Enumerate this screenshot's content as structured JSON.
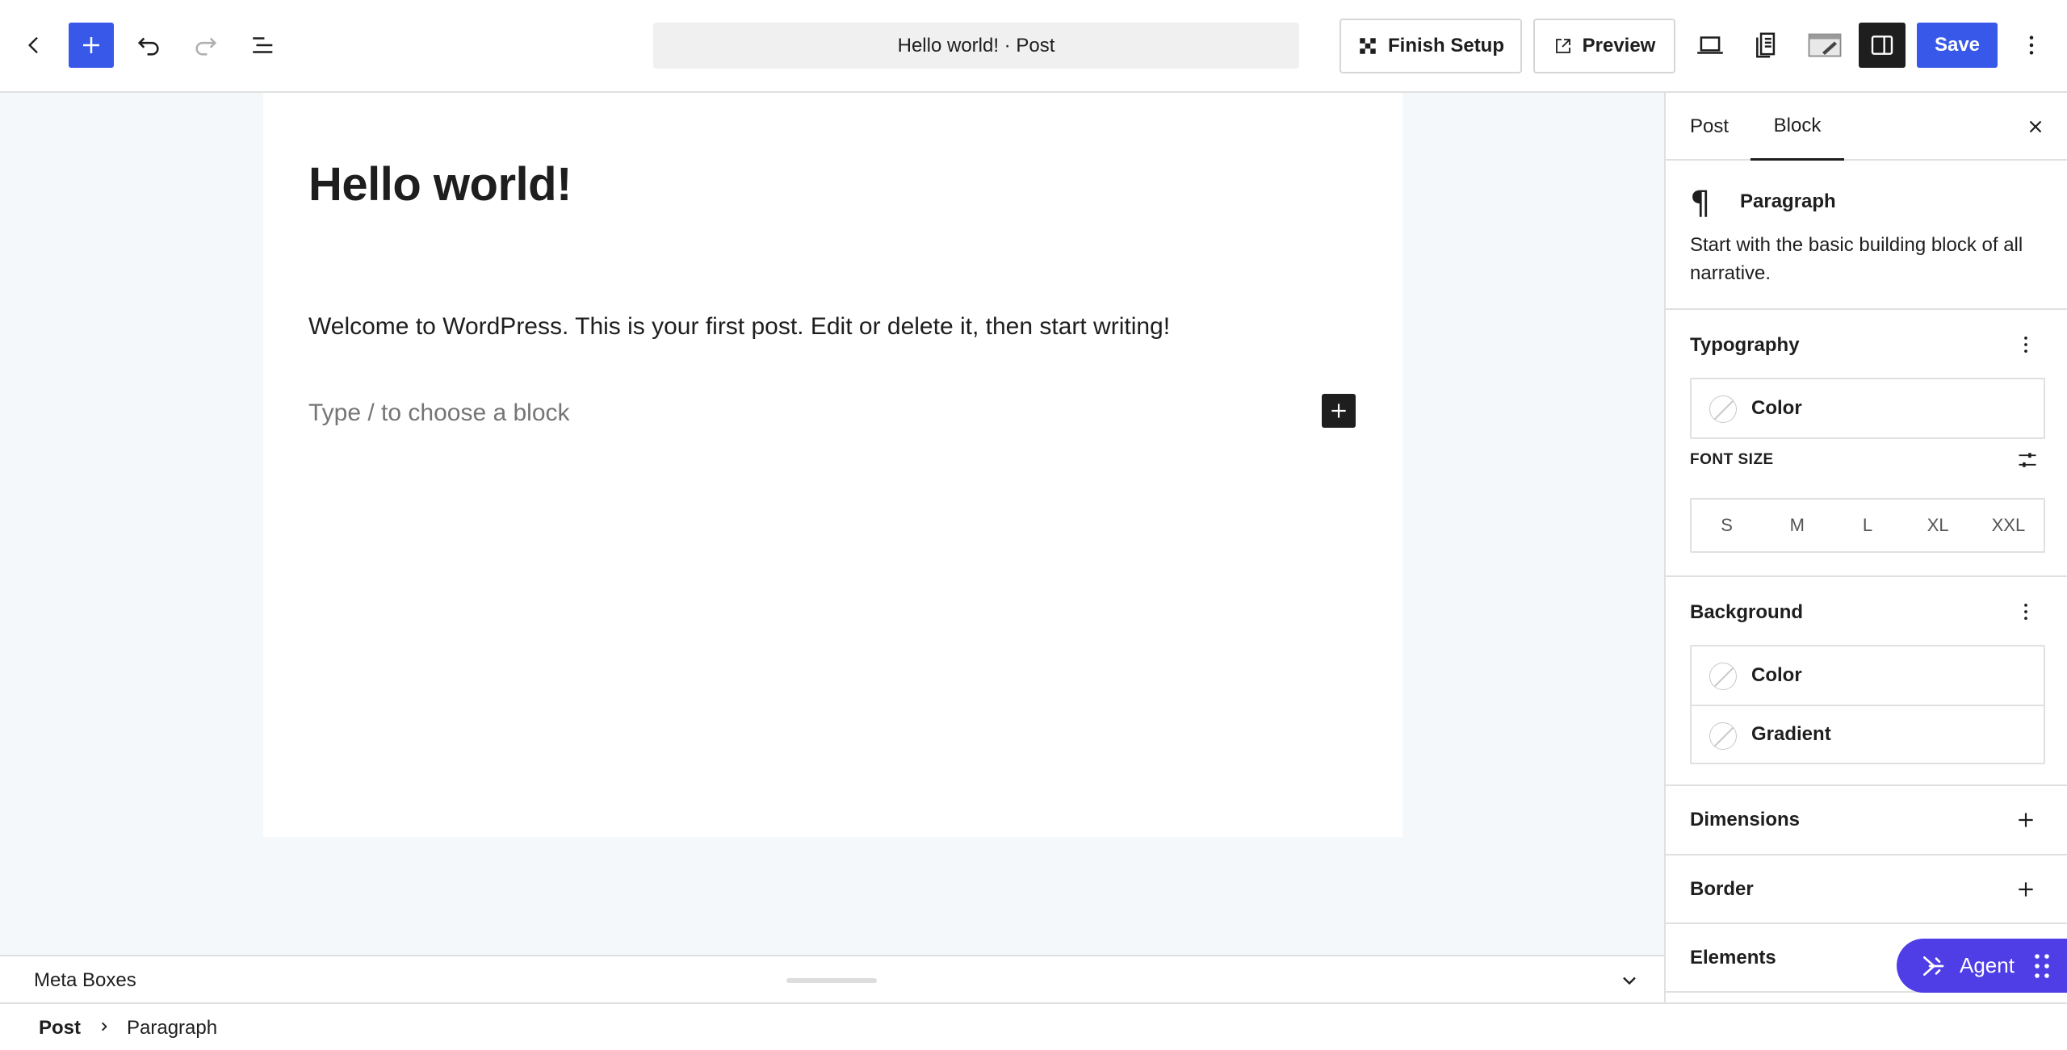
{
  "toolbar": {
    "document_title": "Hello world! · Post",
    "finish_setup_label": "Finish Setup",
    "preview_label": "Preview",
    "save_label": "Save"
  },
  "editor": {
    "post_title": "Hello world!",
    "paragraph_text": "Welcome to WordPress. This is your first post. Edit or delete it, then start writing!",
    "block_placeholder": "Type / to choose a block"
  },
  "meta_boxes": {
    "label": "Meta Boxes"
  },
  "breadcrumb": {
    "items": [
      "Post",
      "Paragraph"
    ]
  },
  "sidebar": {
    "tabs": [
      {
        "label": "Post",
        "active": false
      },
      {
        "label": "Block",
        "active": true
      }
    ],
    "block": {
      "icon": "paragraph-icon",
      "name": "Paragraph",
      "description": "Start with the basic building block of all narrative."
    },
    "typography": {
      "title": "Typography",
      "color_label": "Color",
      "font_size_label": "FONT SIZE",
      "font_sizes": [
        "S",
        "M",
        "L",
        "XL",
        "XXL"
      ]
    },
    "background": {
      "title": "Background",
      "items": [
        "Color",
        "Gradient"
      ]
    },
    "dimensions": {
      "title": "Dimensions"
    },
    "border": {
      "title": "Border"
    },
    "elements": {
      "title": "Elements"
    }
  },
  "agent": {
    "label": "Agent"
  },
  "colors": {
    "accent": "#3858e9",
    "agent": "#4f3ee6",
    "canvas_bg": "#f5f8fb",
    "dark": "#1e1e1e"
  }
}
